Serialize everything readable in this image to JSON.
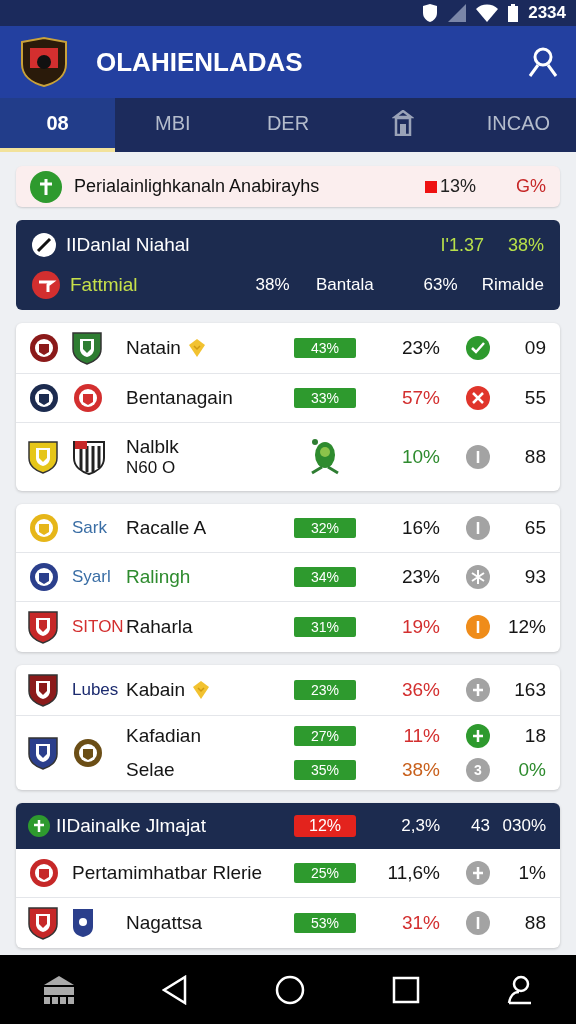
{
  "status_bar": {
    "time": "2334"
  },
  "app_bar": {
    "title": "OLAHIENLADAS"
  },
  "tabs": [
    {
      "kind": "text",
      "label": "08",
      "selected": true
    },
    {
      "kind": "text",
      "label": "MBI",
      "selected": false
    },
    {
      "kind": "text",
      "label": "DER",
      "selected": false
    },
    {
      "kind": "icon",
      "selected": false
    },
    {
      "kind": "text",
      "label": "INCAO",
      "selected": false
    }
  ],
  "banner": {
    "text": "Perialainlighkanaln Anabirayhs",
    "change": "13%",
    "value": "G%"
  },
  "summary": {
    "title": "IIDanlal Niahal",
    "stat_1": "I'1.37",
    "stat_2": "38%",
    "label": "Fattmial",
    "cells": [
      "38%",
      "Bantala",
      "63%",
      "Rimalde"
    ]
  },
  "groups": [
    {
      "rows": [
        {
          "crests": [
            {
              "kind": "round",
              "color": "#8b1a1a"
            },
            {
              "kind": "shield",
              "color": "#2e7d32"
            }
          ],
          "lines": [
            {
              "name": {
                "text": "Natain"
              },
              "trophy": true,
              "pill": "43%",
              "pct": {
                "text": "23%",
                "color": "#151515"
              },
              "status": {
                "kind": "check",
                "color": "#2e9a2e"
              },
              "value": {
                "text": "09",
                "color": "#151515"
              }
            }
          ]
        },
        {
          "crests": [
            {
              "kind": "round",
              "color": "#1c2b4f"
            },
            {
              "kind": "round",
              "color": "#d32f2f"
            }
          ],
          "lines": [
            {
              "name": {
                "text": "Bentanagain"
              },
              "pill": "33%",
              "pct": {
                "text": "57%",
                "color": "#d32f2f"
              },
              "status": {
                "kind": "cross",
                "color": "#e0352b"
              },
              "value": {
                "text": "55",
                "color": "#151515"
              }
            }
          ]
        },
        {
          "crests": [
            {
              "kind": "shield",
              "color": "#e6c619"
            },
            {
              "kind": "stripes",
              "color": "#222222"
            }
          ],
          "lines": [
            {
              "name": {
                "text": "Nalblk"
              },
              "sub": "N60 O",
              "emblem": true,
              "pct": {
                "text": "10%",
                "color": "#2e8b2e"
              },
              "status": {
                "kind": "bar",
                "color": "#a3a3a3"
              },
              "value": {
                "text": "88",
                "color": "#151515"
              }
            }
          ]
        }
      ]
    },
    {
      "rows": [
        {
          "crests": [
            {
              "kind": "round",
              "color": "#e6b619"
            }
          ],
          "code": {
            "text": "Sark",
            "color": "#3a6ea5"
          },
          "lines": [
            {
              "name": {
                "text": "Racalle A"
              },
              "pill": "32%",
              "pct": {
                "text": "16%",
                "color": "#151515"
              },
              "status": {
                "kind": "bar",
                "color": "#a3a3a3"
              },
              "value": {
                "text": "65",
                "color": "#151515"
              }
            }
          ]
        },
        {
          "crests": [
            {
              "kind": "round",
              "color": "#2b3f8c"
            }
          ],
          "code": {
            "text": "Syarl",
            "color": "#3a6ea5"
          },
          "lines": [
            {
              "name": {
                "text": "Ralingh",
                "color": "#2e8b2e"
              },
              "pill": "34%",
              "pct": {
                "text": "23%",
                "color": "#151515"
              },
              "status": {
                "kind": "star",
                "color": "#a3a3a3"
              },
              "value": {
                "text": "93",
                "color": "#151515"
              }
            }
          ]
        },
        {
          "crests": [
            {
              "kind": "shield",
              "color": "#c62828"
            }
          ],
          "code": {
            "text": "SITON",
            "color": "#d32f2f"
          },
          "lines": [
            {
              "name": {
                "text": "Raharla"
              },
              "pill": "31%",
              "pct": {
                "text": "19%",
                "color": "#d32f2f"
              },
              "status": {
                "kind": "bar",
                "color": "#ef8c1a"
              },
              "value": {
                "text": "12%",
                "color": "#151515"
              }
            }
          ]
        }
      ]
    },
    {
      "rows": [
        {
          "crests": [
            {
              "kind": "shield",
              "color": "#8b1a1a"
            }
          ],
          "code": {
            "text": "Lubes",
            "color": "#1c2b6f"
          },
          "lines": [
            {
              "name": {
                "text": "Kabain"
              },
              "trophy": true,
              "pill": "23%",
              "pct": {
                "text": "36%",
                "color": "#d32f2f"
              },
              "status": {
                "kind": "plus",
                "color": "#a3a3a3"
              },
              "value": {
                "text": "163",
                "color": "#151515"
              }
            }
          ]
        },
        {
          "crests": [
            {
              "kind": "shield",
              "color": "#2b3f8c"
            },
            {
              "kind": "round",
              "color": "#6b4e16"
            }
          ],
          "lines": [
            {
              "name": {
                "text": "Kafadian"
              },
              "pill": "27%",
              "pct": {
                "text": "11%",
                "color": "#d32f2f"
              },
              "status": {
                "kind": "plus",
                "color": "#2e9a2e"
              },
              "value": {
                "text": "18",
                "color": "#151515"
              }
            },
            {
              "name": {
                "text": "Selae"
              },
              "pill": "35%",
              "pct": {
                "text": "38%",
                "color": "#c8601c"
              },
              "status": {
                "kind": "text",
                "glyph": "3",
                "color": "#a3a3a3"
              },
              "value": {
                "text": "0%",
                "color": "#2e8b2e"
              }
            }
          ]
        }
      ]
    },
    {
      "header": {
        "title": "IIDainalke Jlmajat",
        "pill": "12%",
        "cells": [
          "2,3%",
          "43",
          "030%"
        ]
      },
      "rows": [
        {
          "crests": [
            {
              "kind": "round",
              "color": "#c62828"
            }
          ],
          "lines": [
            {
              "name": {
                "text": "Pertamimhatbar Rlerie"
              },
              "pill": "25%",
              "pct": {
                "text": "11,6%",
                "color": "#151515"
              },
              "status": {
                "kind": "plus",
                "color": "#a3a3a3"
              },
              "value": {
                "text": "1%",
                "color": "#151515"
              }
            }
          ]
        },
        {
          "crests": [
            {
              "kind": "shield",
              "color": "#c62828"
            },
            {
              "kind": "small",
              "color": "#2b3f8c"
            }
          ],
          "lines": [
            {
              "name": {
                "text": "Nagattsa"
              },
              "pill": "53%",
              "pct": {
                "text": "31%",
                "color": "#d32f2f"
              },
              "status": {
                "kind": "bar",
                "color": "#a3a3a3"
              },
              "value": {
                "text": "88",
                "color": "#151515"
              }
            }
          ]
        }
      ]
    }
  ]
}
